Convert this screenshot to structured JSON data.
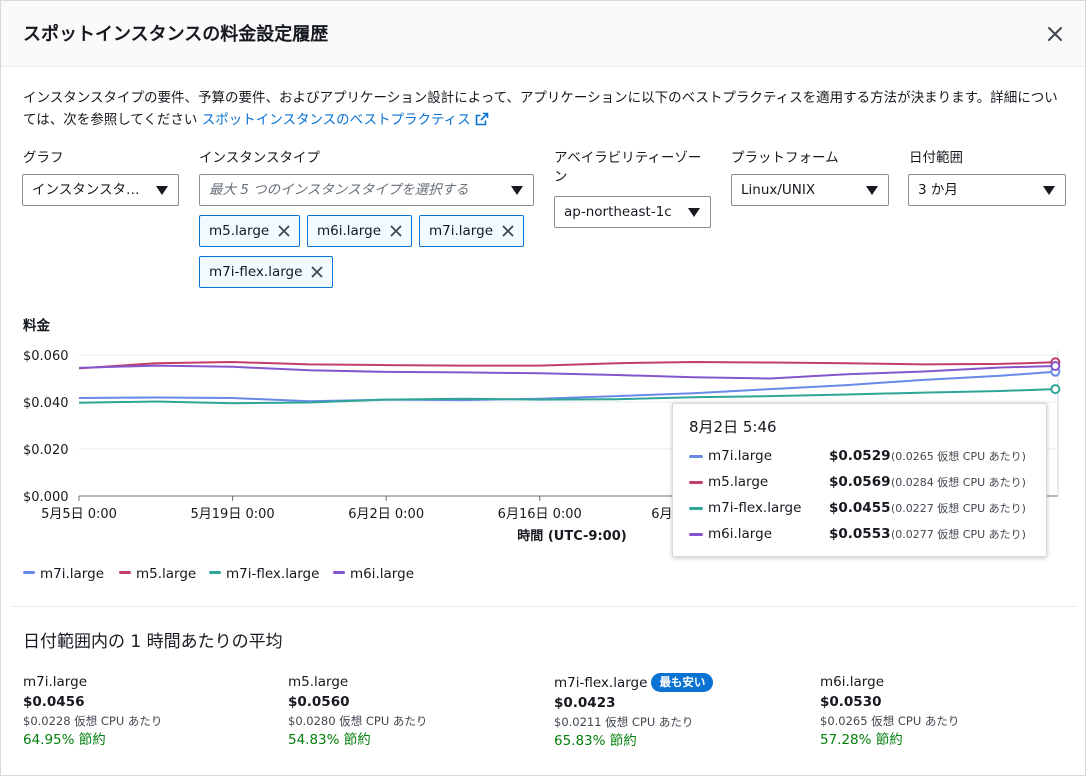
{
  "modal": {
    "title": "スポットインスタンスの料金設定履歴",
    "description_1": "インスタンスタイプの要件、予算の要件、およびアプリケーション設計によって、アプリケーションに以下のベストプラクティスを適用する方法が決まります。詳細については、次を参照してください ",
    "description_link": "スポットインスタンスのベストプラクティス"
  },
  "filters": {
    "graph_label": "グラフ",
    "graph_value": "インスタンスタ…",
    "instance_type_label": "インスタンスタイプ",
    "instance_type_placeholder": "最大 5 つのインスタンスタイプを選択する",
    "az_label": "アベイラビリティーゾーン",
    "az_value": "ap-northeast-1c",
    "platform_label": "プラットフォーム",
    "platform_value": "Linux/UNIX",
    "range_label": "日付範囲",
    "range_value": "3 か月",
    "tokens": [
      "m5.large",
      "m6i.large",
      "m7i.large",
      "m7i-flex.large"
    ]
  },
  "chart_data": {
    "type": "line",
    "title": "料金",
    "xlabel": "時間 (UTC-9:00)",
    "ylabel": "料金",
    "x_tick_labels": [
      "5月5日 0:00",
      "5月19日 0:00",
      "6月2日 0:00",
      "6月16日 0:00",
      "6月30日 0:00"
    ],
    "x_range": [
      "2024-05-05 00:00",
      "2024-08-02 05:46"
    ],
    "y_tick_labels": [
      "$0.000",
      "$0.020",
      "$0.040",
      "$0.060"
    ],
    "ylim": [
      0,
      0.06
    ],
    "grid": true,
    "x": [
      "2024-05-05",
      "2024-05-12",
      "2024-05-19",
      "2024-05-26",
      "2024-06-02",
      "2024-06-09",
      "2024-06-16",
      "2024-06-23",
      "2024-06-30",
      "2024-07-07",
      "2024-07-14",
      "2024-07-21",
      "2024-07-28",
      "2024-08-02"
    ],
    "series": [
      {
        "name": "m7i.large",
        "color": "#688ae8",
        "values": [
          0.0417,
          0.0419,
          0.0417,
          0.0403,
          0.041,
          0.0408,
          0.0414,
          0.0425,
          0.0437,
          0.0455,
          0.0472,
          0.0494,
          0.0512,
          0.0529
        ]
      },
      {
        "name": "m5.large",
        "color": "#c33d69",
        "values": [
          0.0543,
          0.0565,
          0.057,
          0.056,
          0.0557,
          0.0555,
          0.0555,
          0.0565,
          0.057,
          0.0568,
          0.0565,
          0.056,
          0.0562,
          0.0569
        ]
      },
      {
        "name": "m7i-flex.large",
        "color": "#2ea597",
        "values": [
          0.0397,
          0.0402,
          0.0395,
          0.0398,
          0.041,
          0.0414,
          0.041,
          0.0412,
          0.042,
          0.0425,
          0.0432,
          0.044,
          0.0447,
          0.0455
        ]
      },
      {
        "name": "m6i.large",
        "color": "#8456ce",
        "values": [
          0.0545,
          0.0555,
          0.055,
          0.0535,
          0.0528,
          0.0526,
          0.0522,
          0.0515,
          0.0505,
          0.05,
          0.0518,
          0.053,
          0.0547,
          0.0553
        ]
      }
    ]
  },
  "tooltip": {
    "title": "8月2日 5:46",
    "rows": [
      {
        "name": "m7i.large",
        "price": "$0.0529",
        "cpu": "(0.0265 仮想 CPU あたり)",
        "color": "#688ae8"
      },
      {
        "name": "m5.large",
        "price": "$0.0569",
        "cpu": "(0.0284 仮想 CPU あたり)",
        "color": "#c33d69"
      },
      {
        "name": "m7i-flex.large",
        "price": "$0.0455",
        "cpu": "(0.0227 仮想 CPU あたり)",
        "color": "#2ea597"
      },
      {
        "name": "m6i.large",
        "price": "$0.0553",
        "cpu": "(0.0277 仮想 CPU あたり)",
        "color": "#8456ce"
      }
    ]
  },
  "legend": [
    {
      "name": "m7i.large",
      "color": "#688ae8"
    },
    {
      "name": "m5.large",
      "color": "#c33d69"
    },
    {
      "name": "m7i-flex.large",
      "color": "#2ea597"
    },
    {
      "name": "m6i.large",
      "color": "#8456ce"
    }
  ],
  "averages": {
    "title": "日付範囲内の 1 時間あたりの平均",
    "cheapest_badge": "最も安い",
    "items": [
      {
        "name": "m7i.large",
        "price": "$0.0456",
        "cpu": "$0.0228 仮想 CPU あたり",
        "savings": "64.95% 節約"
      },
      {
        "name": "m5.large",
        "price": "$0.0560",
        "cpu": "$0.0280 仮想 CPU あたり",
        "savings": "54.83% 節約"
      },
      {
        "name": "m7i-flex.large",
        "price": "$0.0423",
        "cpu": "$0.0211 仮想 CPU あたり",
        "savings": "65.83% 節約"
      },
      {
        "name": "m6i.large",
        "price": "$0.0530",
        "cpu": "$0.0265 仮想 CPU あたり",
        "savings": "57.28% 節約"
      }
    ]
  }
}
